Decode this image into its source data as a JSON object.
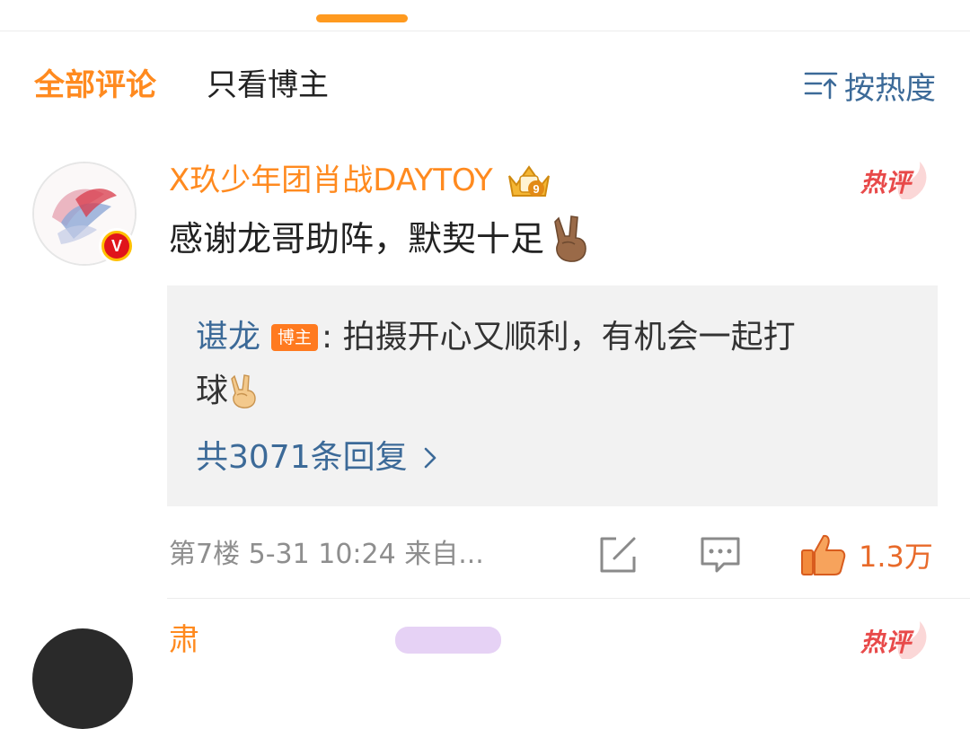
{
  "tabs": [
    "全部评论",
    "只看博主"
  ],
  "sort_label": "按热度",
  "comment": {
    "username": "X玖少年团肖战DAYTOY",
    "user_level": "9",
    "verified_badge": "V",
    "hot_tag": "热评",
    "text": "感谢龙哥助阵，默契十足",
    "emoji": "victory-hand-icon",
    "reply": {
      "author": "谌龙",
      "author_badge": "博主",
      "text_line1": ": 拍摄开心又顺利，有机会一起打",
      "text_line2": "球",
      "more": "共3071条回复"
    },
    "meta": "第7楼  5-31 10:24  来自...",
    "likes": "1.3万"
  },
  "next_comment": {
    "username": "肃",
    "hot_tag": "热评"
  },
  "colors": {
    "accent": "#ff8a1f",
    "link": "#3c6a98",
    "hot": "#e84a4a",
    "like": "#e86a2a"
  }
}
